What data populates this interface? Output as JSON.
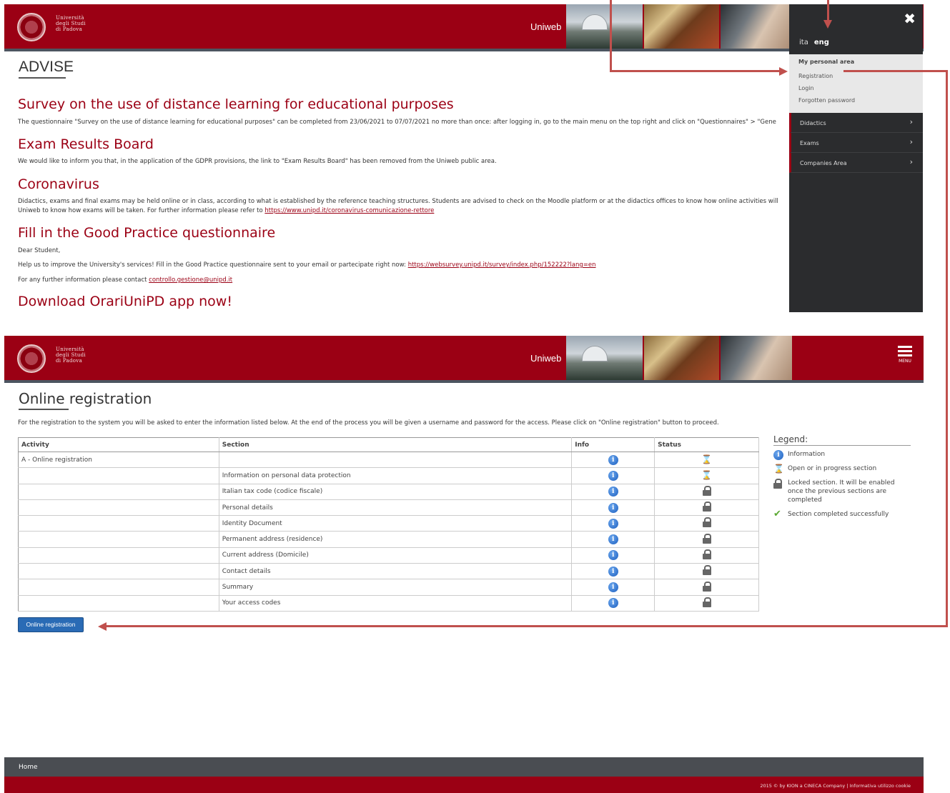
{
  "university_logo_text": [
    "Università",
    "degli Studi",
    "di Padova"
  ],
  "site_name": "Uniweb",
  "top": {
    "advise_title": "ADVISE",
    "news": [
      {
        "heading": "Survey on the use of distance learning for educational purposes",
        "text": "The questionnaire \"Survey on the use of distance learning for educational purposes\" can be completed from 23/06/2021 to 07/07/2021 no more than once: after logging in, go to the main menu on the top right and click on \"Questionnaires\" > \"Gene"
      },
      {
        "heading": "Exam Results Board",
        "text": "We would like to inform you that, in the application of the GDPR provisions, the link to \"Exam Results Board\" has been removed from the Uniweb public area."
      },
      {
        "heading": "Coronavirus",
        "text": "Didactics, exams and final exams may be held online or in class, according to what is established by the reference teaching structures. Students are advised to check on the Moodle platform or at the didactics offices to know how online activities will",
        "text2": "Uniweb to know how exams will be taken. For further information please refer to",
        "link": "https://www.unipd.it/coronavirus-comunicazione-rettore"
      },
      {
        "heading": "Fill in the Good Practice questionnaire",
        "line1": "Dear Student,",
        "line2": "Help us to improve the University's services! Fill in the Good Practice questionnaire sent to your email or partecipate right now:",
        "link": "https://websurvey.unipd.it/survey/index.php/152222?lang=en",
        "line3": "For any further information please contact",
        "email": "controllo.gestione@unipd.it"
      },
      {
        "heading": "Download OrariUniPD app now!"
      }
    ],
    "menu": {
      "close_icon": "close-icon",
      "lang_ita": "ita",
      "lang_eng": "eng",
      "personal_area_title": "My personal area",
      "personal_area_items": [
        "Registration",
        "Login",
        "Forgotten password"
      ],
      "sections": [
        "Didactics",
        "Exams",
        "Companies Area"
      ],
      "chevron": "›"
    }
  },
  "bottom": {
    "menu_label": "MENU",
    "title": "Online registration",
    "intro": "For the registration to the system you will be asked to enter the information listed below. At the end of the process you will be given a username and password for the access. Please click on \"Online registration\" button to proceed.",
    "table": {
      "headers": [
        "Activity",
        "Section",
        "Info",
        "Status"
      ],
      "rows": [
        {
          "activity": "A - Online registration",
          "section": "",
          "status": "open"
        },
        {
          "activity": "",
          "section": "Information on personal data protection",
          "status": "open"
        },
        {
          "activity": "",
          "section": "Italian tax code (codice fiscale)",
          "status": "locked"
        },
        {
          "activity": "",
          "section": "Personal details",
          "status": "locked"
        },
        {
          "activity": "",
          "section": "Identity Document",
          "status": "locked"
        },
        {
          "activity": "",
          "section": "Permanent address (residence)",
          "status": "locked"
        },
        {
          "activity": "",
          "section": "Current address (Domicile)",
          "status": "locked"
        },
        {
          "activity": "",
          "section": "Contact details",
          "status": "locked"
        },
        {
          "activity": "",
          "section": "Summary",
          "status": "locked"
        },
        {
          "activity": "",
          "section": "Your access codes",
          "status": "locked"
        }
      ]
    },
    "legend": {
      "title": "Legend:",
      "information": "Information",
      "open": "Open or in progress section",
      "locked": "Locked section. It will be enabled once the previous sections are completed",
      "completed": "Section completed successfully"
    },
    "button": "Online registration"
  },
  "footer": {
    "home": "Home",
    "copyright": "2015 © by KION a CINECA Company | Informativa utilizzo cookie"
  },
  "colors": {
    "brand": "#9b0014",
    "annotation": "#c0504d",
    "button": "#2a6bb5"
  }
}
